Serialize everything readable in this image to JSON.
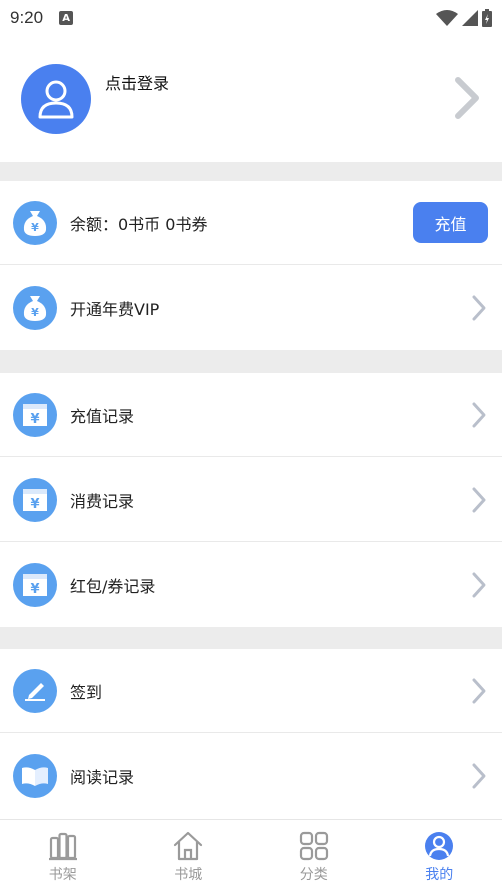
{
  "status_bar": {
    "time": "9:20",
    "notification_icon": "A"
  },
  "profile": {
    "login_text": "点击登录"
  },
  "account": {
    "balance_text": "余额：0书币  0书券",
    "recharge_button": "充值",
    "vip_label": "开通年费VIP"
  },
  "records": [
    {
      "label": "充值记录"
    },
    {
      "label": "消费记录"
    },
    {
      "label": "红包/券记录"
    }
  ],
  "activity": [
    {
      "label": "签到"
    },
    {
      "label": "阅读记录"
    }
  ],
  "bottom_nav": [
    {
      "label": "书架",
      "icon": "bookshelf-icon",
      "active": false
    },
    {
      "label": "书城",
      "icon": "home-icon",
      "active": false
    },
    {
      "label": "分类",
      "icon": "category-grid-icon",
      "active": false
    },
    {
      "label": "我的",
      "icon": "user-icon",
      "active": true
    }
  ],
  "colors": {
    "accent": "#4a80ef",
    "icon_bg": "#5aa1ef",
    "divider": "#ececec"
  }
}
